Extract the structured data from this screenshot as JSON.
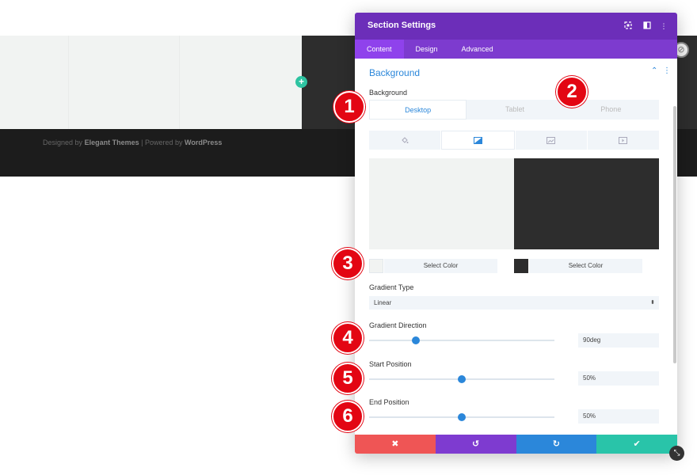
{
  "footer": {
    "designed_by": "Designed by",
    "elegant_themes": "Elegant Themes",
    "separator": "| Powered by",
    "wordpress": "WordPress"
  },
  "modal": {
    "title": "Section Settings",
    "tabs": [
      {
        "label": "Content",
        "active": true
      },
      {
        "label": "Design",
        "active": false
      },
      {
        "label": "Advanced",
        "active": false
      }
    ],
    "section": {
      "title": "Background",
      "background_label": "Background",
      "device_tabs": [
        {
          "label": "Desktop",
          "active": true
        },
        {
          "label": "Tablet",
          "active": false
        },
        {
          "label": "Phone",
          "active": false
        }
      ],
      "bg_types": [
        {
          "icon": "paint-bucket-icon",
          "active": false
        },
        {
          "icon": "gradient-icon",
          "active": true
        },
        {
          "icon": "image-icon",
          "active": false
        },
        {
          "icon": "video-icon",
          "active": false
        }
      ],
      "gradient_start_color": "#f1f3f2",
      "gradient_end_color": "#2d2d2d",
      "color_stops": [
        {
          "label": "Select Color",
          "swatch": "#f1f3f2"
        },
        {
          "label": "Select Color",
          "swatch": "#2d2d2d"
        }
      ],
      "gradient_type_label": "Gradient Type",
      "gradient_type_value": "Linear",
      "gradient_direction_label": "Gradient Direction",
      "gradient_direction_value": "90deg",
      "gradient_direction_fraction": 0.25,
      "start_position_label": "Start Position",
      "start_position_value": "50%",
      "start_position_fraction": 0.5,
      "end_position_label": "End Position",
      "end_position_value": "50%",
      "end_position_fraction": 0.5
    },
    "footer_buttons": [
      {
        "icon": "close-icon",
        "glyph": "✖",
        "color": "#ef5555"
      },
      {
        "icon": "undo-icon",
        "glyph": "↺",
        "color": "#7e3bd0"
      },
      {
        "icon": "redo-icon",
        "glyph": "↻",
        "color": "#2b87da"
      },
      {
        "icon": "check-icon",
        "glyph": "✔",
        "color": "#29c4a9"
      }
    ]
  },
  "callouts": [
    "1",
    "2",
    "3",
    "4",
    "5",
    "6"
  ],
  "colors": {
    "header_purple": "#6c2eb9",
    "tab_bar_purple": "#7d3bcf",
    "accent_blue": "#2b87da",
    "add_button_teal": "#2ec3a1",
    "callout_red": "#e30613"
  }
}
